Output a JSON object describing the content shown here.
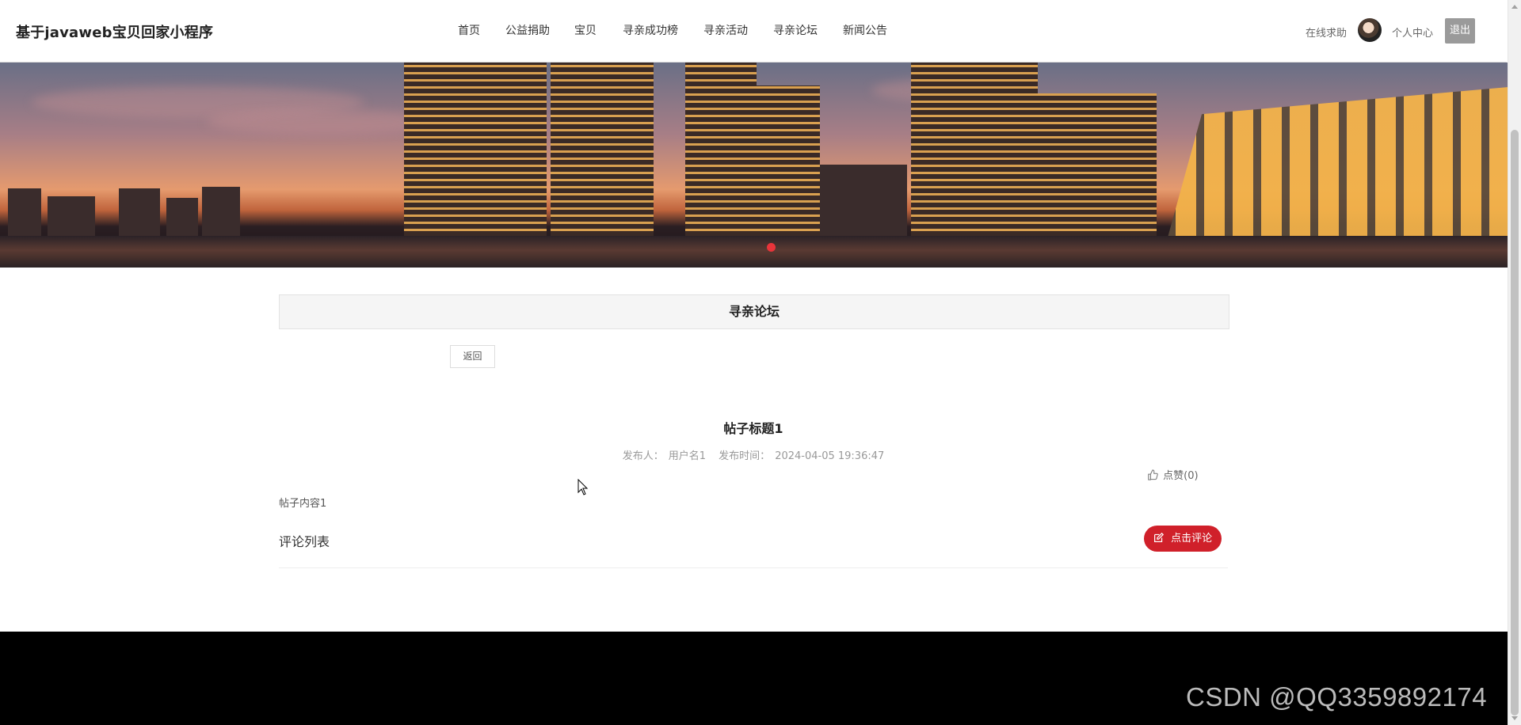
{
  "header": {
    "site_title": "基于javaweb宝贝回家小程序",
    "nav": [
      "首页",
      "公益捐助",
      "宝贝",
      "寻亲成功榜",
      "寻亲活动",
      "寻亲论坛",
      "新闻公告"
    ],
    "help_link": "在线求助",
    "center_link": "个人中心",
    "logout_label": "退出"
  },
  "section": {
    "title": "寻亲论坛"
  },
  "back_label": "返回",
  "post": {
    "title": "帖子标题1",
    "author_label": "发布人：",
    "author": "用户名1",
    "time_label": "发布时间：",
    "time": "2024-04-05 19:36:47",
    "like_label": "点赞(0)",
    "content": "帖子内容1"
  },
  "comments": {
    "heading": "评论列表",
    "add_label": "点击评论"
  },
  "watermark": "CSDN @QQ3359892174",
  "colors": {
    "accent_red": "#d0202a",
    "carousel_dot": "#e8343a",
    "footer_bg": "#000000"
  },
  "icons": [
    "user-avatar",
    "thumbs-up-icon",
    "edit-icon"
  ]
}
